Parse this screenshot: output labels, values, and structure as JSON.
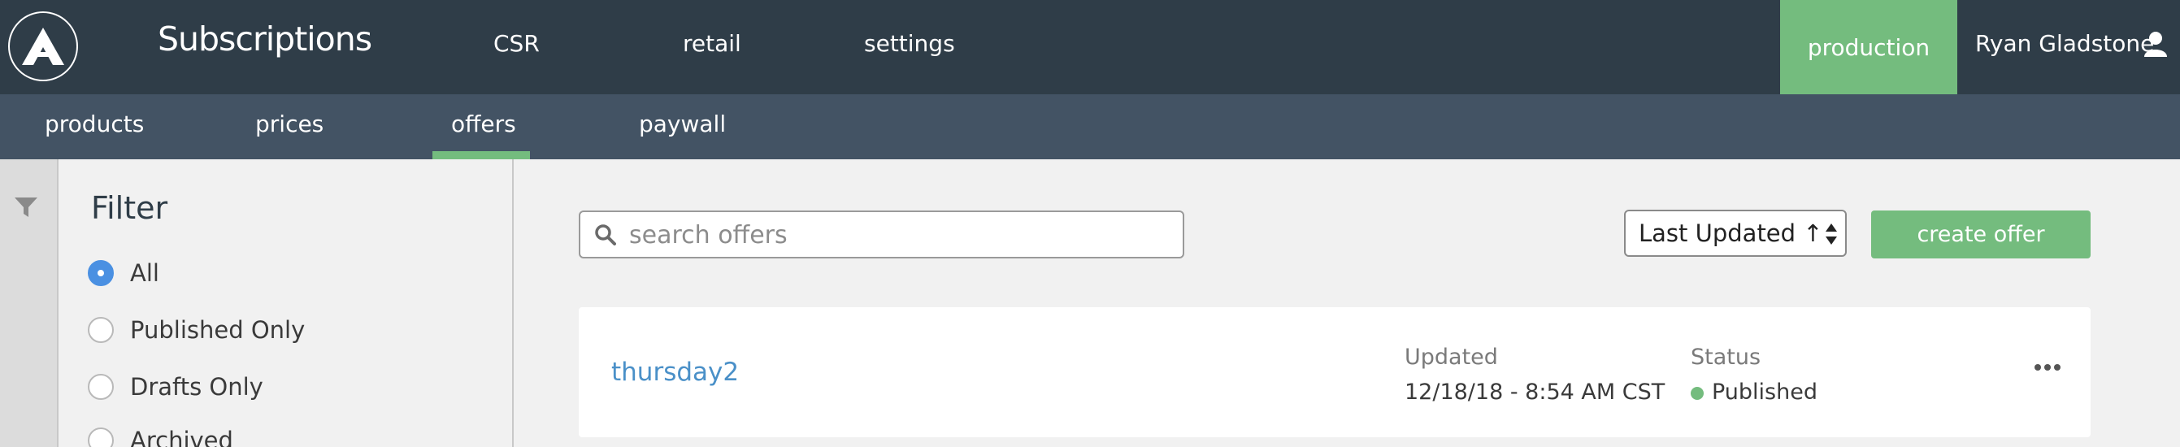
{
  "header": {
    "app_title": "Subscriptions",
    "nav": [
      "CSR",
      "retail",
      "settings"
    ],
    "environment": "production",
    "user_name": "Ryan Gladstone"
  },
  "subnav": {
    "items": [
      "products",
      "prices",
      "offers",
      "paywall"
    ],
    "active": "offers"
  },
  "filter": {
    "title": "Filter",
    "options": [
      "All",
      "Published Only",
      "Drafts Only",
      "Archived"
    ],
    "selected": "All"
  },
  "toolbar": {
    "search_placeholder": "search offers",
    "sort_label": "Last Updated ↑",
    "create_label": "create offer"
  },
  "offers": [
    {
      "name": "thursday2",
      "updated_label": "Updated",
      "updated_value": "12/18/18 - 8:54 AM CST",
      "status_label": "Status",
      "status_value": "Published"
    }
  ],
  "colors": {
    "topbar": "#2f3d48",
    "subnav": "#435364",
    "accent_green": "#74bc7e",
    "link_blue": "#4a90c8",
    "radio_blue": "#4a90e2"
  },
  "icons": [
    "logo-icon",
    "user-icon",
    "filter-icon",
    "search-icon",
    "sort-arrows-icon",
    "more-options-icon",
    "status-dot-icon"
  ]
}
